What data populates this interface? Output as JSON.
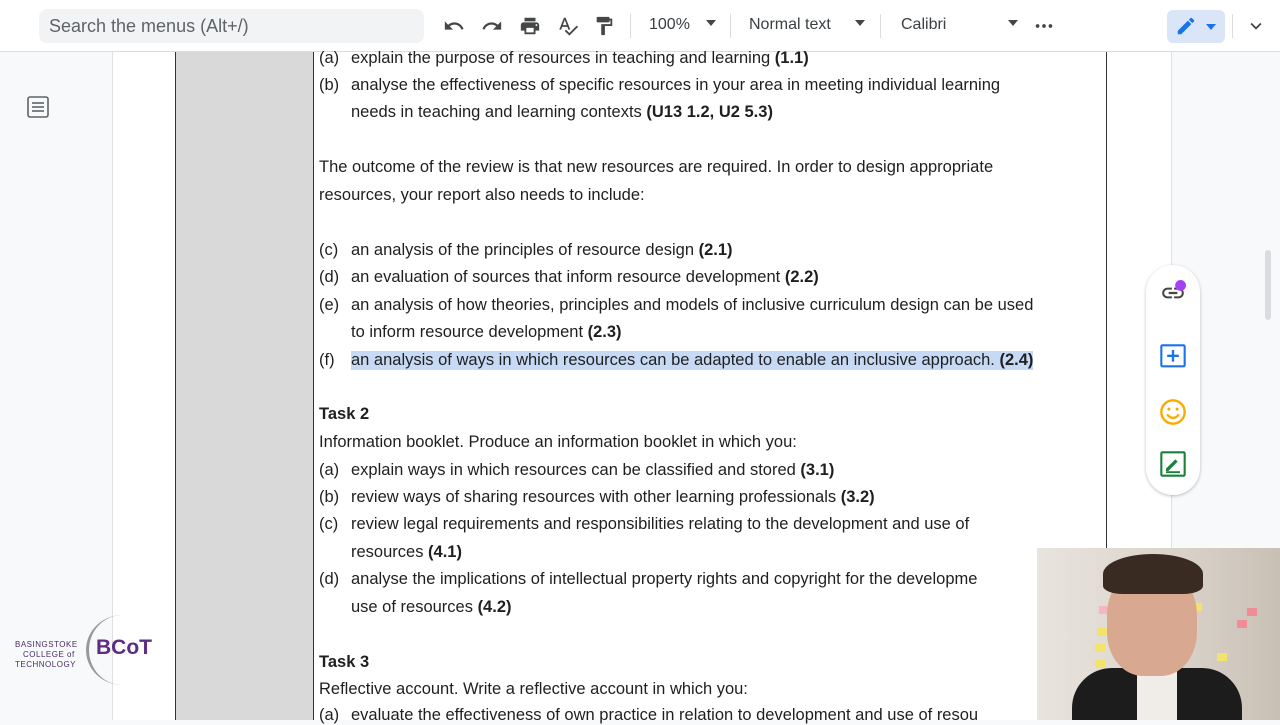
{
  "toolbar": {
    "search_placeholder": "Search the menus (Alt+/)",
    "zoom": "100%",
    "style": "Normal text",
    "font": "Calibri"
  },
  "document": {
    "intro_items": [
      {
        "label": "(a)",
        "text": "explain the purpose of resources in teaching and learning ",
        "ref": "(1.1)"
      },
      {
        "label": "(b)",
        "text": "analyse the effectiveness of specific resources in your area in meeting individual learning",
        "text2": "needs in teaching and learning contexts  ",
        "ref": "(U13 1.2, U2 5.3)"
      }
    ],
    "outcome_line1": "The outcome of the review is that new resources are required. In order to design appropriate",
    "outcome_line2": "resources, your report also needs to include:",
    "report_items": [
      {
        "label": "(c)",
        "text": "an analysis of the principles of resource design ",
        "ref": "(2.1)"
      },
      {
        "label": "(d)",
        "text": "an evaluation of sources that inform resource development ",
        "ref": "(2.2)"
      },
      {
        "label": "(e)",
        "text": "an analysis of how theories, principles and models of inclusive curriculum design can be used",
        "text2": "to inform resource development ",
        "ref": "(2.3)"
      },
      {
        "label": "(f)",
        "text": "an analysis of ways in which resources can be adapted to enable an inclusive approach. ",
        "ref": "(2.4)"
      }
    ],
    "task2_title": "Task 2",
    "task2_intro": "Information booklet. Produce an information booklet in which you:",
    "task2_items": [
      {
        "label": "(a)",
        "text": "explain ways in which resources can be classified and stored ",
        "ref": "(3.1)"
      },
      {
        "label": "(b)",
        "text": "review ways of sharing resources with other learning professionals ",
        "ref": "(3.2)"
      },
      {
        "label": "(c)",
        "text": "review legal requirements and responsibilities relating to the development and use of",
        "text2": "resources ",
        "ref": "(4.1)"
      },
      {
        "label": "(d)",
        "text": "analyse the implications of intellectual property rights and copyright for the developme",
        "text2": "use of resources ",
        "ref": "(4.2)"
      }
    ],
    "task3_title": "Task 3",
    "task3_intro": "Reflective account. Write a reflective account in which you:",
    "task3_partial": "evaluate the effectiveness of own practice in relation to development and use of resou",
    "task3_label": "(a)"
  },
  "logo": {
    "line1": "BASINGSTOKE",
    "line2": "COLLEGE of",
    "line3": "TECHNOLOGY",
    "mark": "BCoT"
  },
  "colors": {
    "highlight": "#c7daf5",
    "accent": "#1a73e8",
    "brand": "#5c2d82"
  }
}
